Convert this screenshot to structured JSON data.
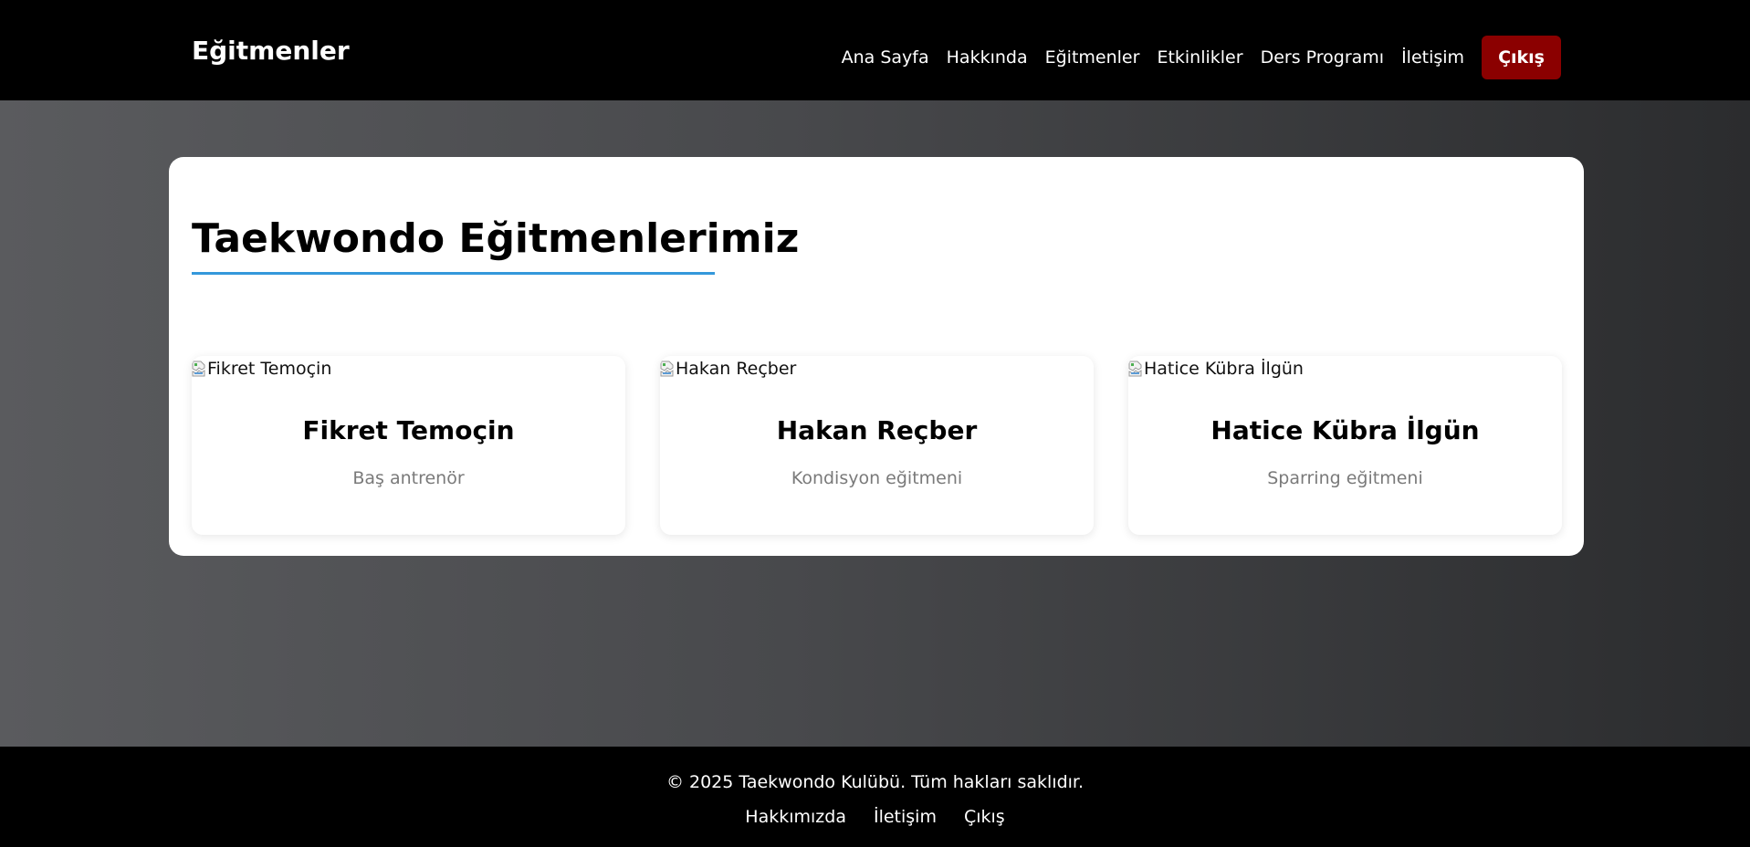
{
  "header": {
    "brand": "Eğitmenler",
    "nav": [
      {
        "label": "Ana Sayfa"
      },
      {
        "label": "Hakkında"
      },
      {
        "label": "Eğitmenler"
      },
      {
        "label": "Etkinlikler"
      },
      {
        "label": "Ders Programı"
      },
      {
        "label": "İletişim"
      }
    ],
    "logout_label": "Çıkış",
    "logout_color": "#8b0000"
  },
  "main": {
    "title": "Taekwondo Eğitmenlerimiz",
    "accent_color": "#3498db",
    "instructors": [
      {
        "image_alt": "Fikret Temoçin",
        "name": "Fikret Temoçin",
        "role": "Baş antrenör",
        "image_icon": "broken-image-icon"
      },
      {
        "image_alt": "Hakan Reçber",
        "name": "Hakan Reçber",
        "role": "Kondisyon eğitmeni",
        "image_icon": "broken-image-icon"
      },
      {
        "image_alt": "Hatice Kübra İlgün",
        "name": "Hatice Kübra İlgün",
        "role": "Sparring eğitmeni",
        "image_icon": "broken-image-icon"
      }
    ]
  },
  "footer": {
    "copyright": "© 2025 Taekwondo Kulübü. Tüm hakları saklıdır.",
    "links": [
      {
        "label": "Hakkımızda"
      },
      {
        "label": "İletişim"
      },
      {
        "label": "Çıkış"
      }
    ]
  }
}
